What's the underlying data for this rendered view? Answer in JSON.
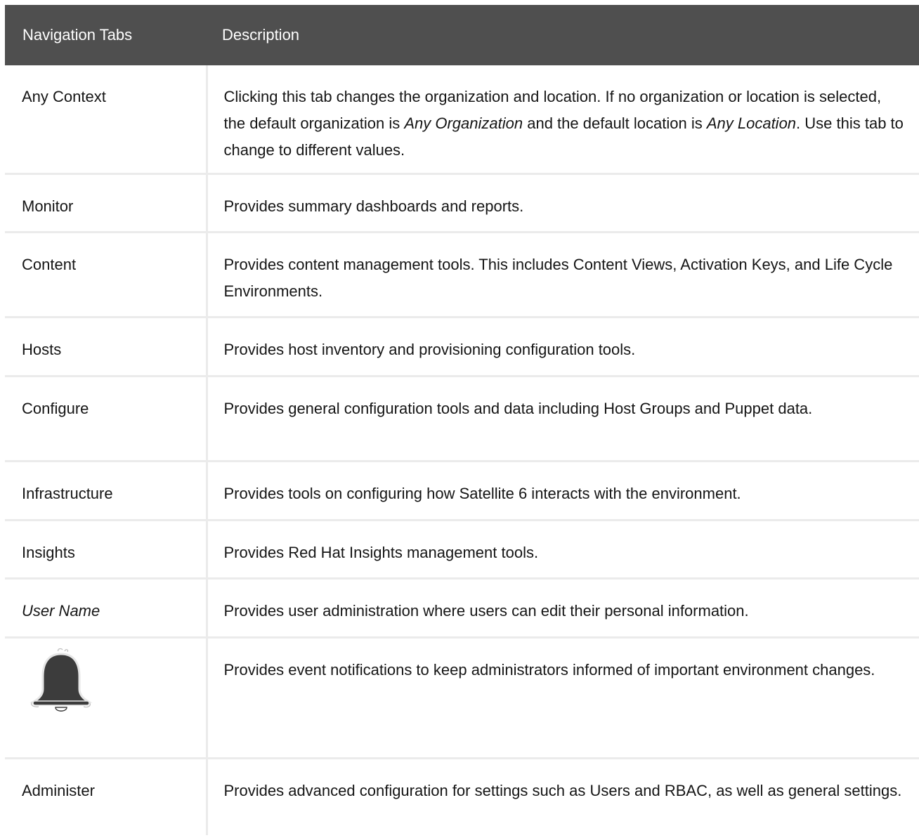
{
  "header": {
    "col1": "Navigation Tabs",
    "col2": "Description"
  },
  "rows": [
    {
      "name": "Any Context",
      "desc_parts": [
        "Clicking this tab changes the organization and location. If no organization or location is selected, the default organization is ",
        "Any Organization",
        " and the default location is ",
        "Any Location",
        ". Use this tab to change to different values."
      ]
    },
    {
      "name": "Monitor",
      "desc": "Provides summary dashboards and reports."
    },
    {
      "name": "Content",
      "desc": "Provides content management tools. This includes Content Views, Activation Keys, and Life Cycle Environments."
    },
    {
      "name": "Hosts",
      "desc": "Provides host inventory and provisioning configuration tools."
    },
    {
      "name": "Configure",
      "desc": "Provides general configuration tools and data including Host Groups and Puppet data."
    },
    {
      "name": "Infrastructure",
      "desc": "Provides tools on configuring how Satellite 6 interacts with the environment."
    },
    {
      "name": "Insights",
      "desc": "Provides Red Hat Insights management tools."
    },
    {
      "name": "User Name",
      "desc": "Provides user administration where users can edit their personal information."
    },
    {
      "icon": "bell-icon",
      "desc": "Provides event notifications to keep administrators informed of important environment changes."
    },
    {
      "name": "Administer",
      "desc": "Provides advanced configuration for settings such as Users and RBAC, as well as general settings."
    }
  ],
  "colors": {
    "header_bg": "#4f4f4f",
    "header_text": "#ffffff",
    "border": "#ebebeb",
    "text": "#151515",
    "bell_fill": "#3c3c3c"
  }
}
